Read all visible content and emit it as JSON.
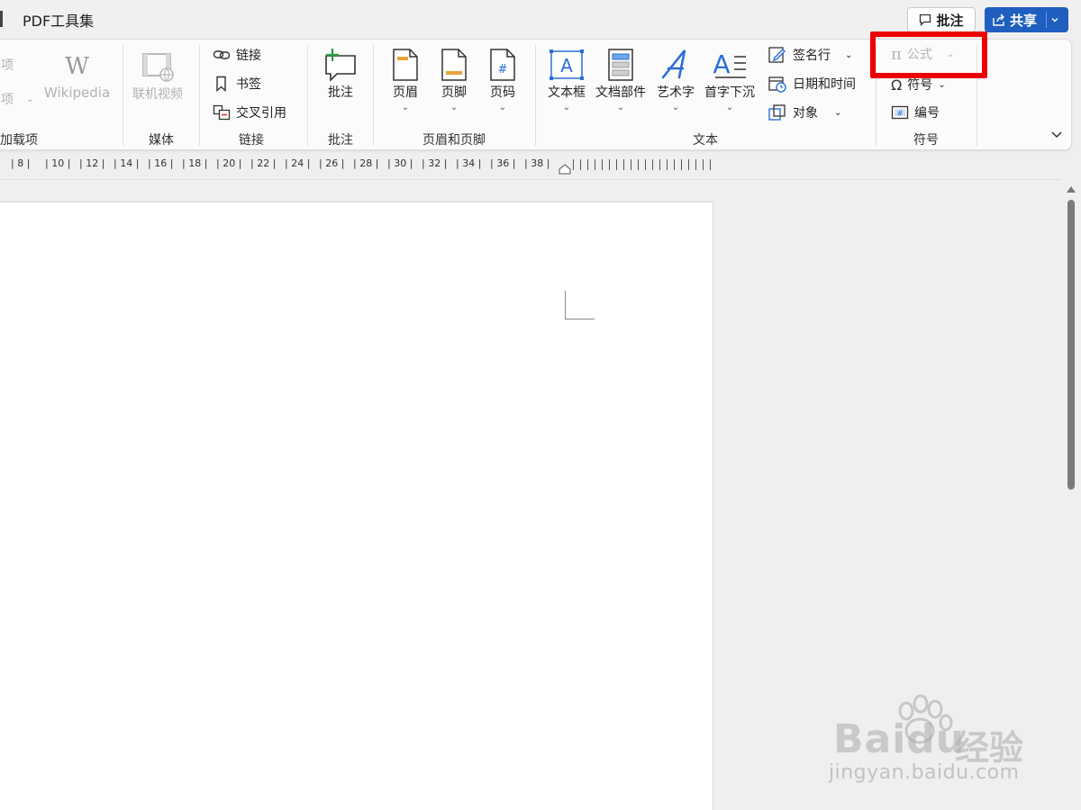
{
  "titlebar": {
    "menu_tab": "PDF工具集",
    "comment_button": "批注",
    "share_button": "共享"
  },
  "ribbon": {
    "addins": {
      "item1": "项",
      "item2": "项",
      "group": "加载项"
    },
    "wikipedia": {
      "label": "Wikipedia"
    },
    "media": {
      "online_video": "联机视频",
      "group": "媒体"
    },
    "links": {
      "link": "链接",
      "bookmark": "书签",
      "cross_reference": "交叉引用",
      "group": "链接"
    },
    "comments": {
      "comment": "批注",
      "group": "批注"
    },
    "header_footer": {
      "header": "页眉",
      "footer": "页脚",
      "page_number": "页码",
      "group": "页眉和页脚"
    },
    "text": {
      "textbox": "文本框",
      "quick_parts": "文档部件",
      "wordart": "艺术字",
      "dropcap": "首字下沉",
      "signature_line": "签名行",
      "date_time": "日期和时间",
      "object": "对象",
      "group": "文本"
    },
    "symbols": {
      "equation": "公式",
      "symbol": "符号",
      "number": "编号",
      "group": "符号"
    }
  },
  "ruler": {
    "labels": [
      "8",
      "10",
      "12",
      "14",
      "16",
      "18",
      "20",
      "22",
      "24",
      "26",
      "28",
      "30",
      "32",
      "34",
      "36",
      "38"
    ]
  },
  "watermark": {
    "brand": "Baidu",
    "brand_cn": "经验",
    "url": "jingyan.baidu.com"
  },
  "colors": {
    "share_blue": "#1f5fbf",
    "highlight_red": "#ee0000",
    "icon_blue": "#2b6fd6",
    "icon_orange": "#e8a33b"
  }
}
